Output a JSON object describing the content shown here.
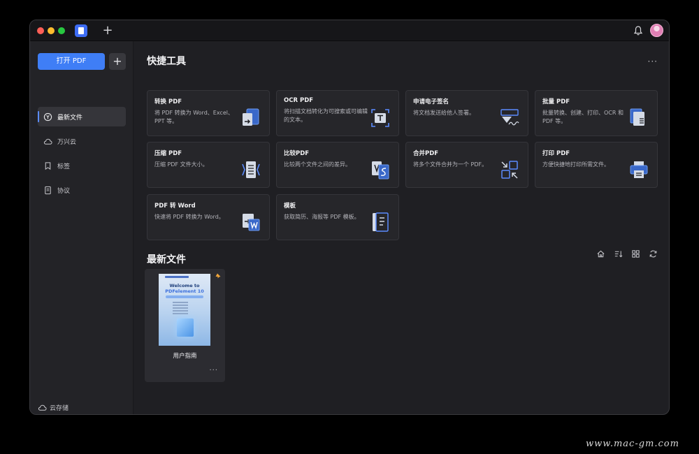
{
  "titlebar": {
    "new_tab_label": "+"
  },
  "sidebar": {
    "open_pdf_label": "打开 PDF",
    "add_label": "+",
    "items": [
      {
        "label": "最新文件",
        "icon": "recent-icon",
        "active": true
      },
      {
        "label": "万兴云",
        "icon": "cloud-icon",
        "active": false
      },
      {
        "label": "标签",
        "icon": "bookmark-icon",
        "active": false
      },
      {
        "label": "协议",
        "icon": "document-icon",
        "active": false
      }
    ],
    "cloud_storage_label": "云存储"
  },
  "quick_tools": {
    "title": "快捷工具",
    "more_label": "···",
    "tools": [
      {
        "title": "转换 PDF",
        "desc": "将 PDF 转换为 Word、Excel、PPT 等。",
        "icon": "convert-icon"
      },
      {
        "title": "OCR PDF",
        "desc": "将扫描文档转化为可搜索或可编辑的文本。",
        "icon": "ocr-icon"
      },
      {
        "title": "申请电子签名",
        "desc": "将文档发送给他人签署。",
        "icon": "signature-icon"
      },
      {
        "title": "批量 PDF",
        "desc": "批量转换、创建、打印、OCR 和 PDF 等。",
        "icon": "batch-icon"
      },
      {
        "title": "压缩 PDF",
        "desc": "压缩 PDF 文件大小。",
        "icon": "compress-icon"
      },
      {
        "title": "比较PDF",
        "desc": "比较两个文件之间的差异。",
        "icon": "compare-icon"
      },
      {
        "title": "合并PDF",
        "desc": "将多个文件合并为一个 PDF。",
        "icon": "merge-icon"
      },
      {
        "title": "打印 PDF",
        "desc": "方便快捷地打印所需文件。",
        "icon": "print-icon"
      },
      {
        "title": "PDF 转 Word",
        "desc": "快速将 PDF 转换为 Word。",
        "icon": "pdf-to-word-icon"
      },
      {
        "title": "模板",
        "desc": "获取简历、海报等 PDF 模板。",
        "icon": "template-icon"
      }
    ]
  },
  "recent_files": {
    "title": "最新文件",
    "toolbar_icons": [
      "home-icon",
      "sort-icon",
      "grid-view-icon",
      "refresh-icon"
    ],
    "files": [
      {
        "name": "用户指南",
        "thumb_welcome": "Welcome to",
        "thumb_brand": "PDFelement 10",
        "pinned": true,
        "more_label": "···"
      }
    ]
  },
  "watermark": "www.mac-gm.com",
  "colors": {
    "accent": "#3f7ef6",
    "background": "#1f1f23",
    "card": "#26262a"
  }
}
